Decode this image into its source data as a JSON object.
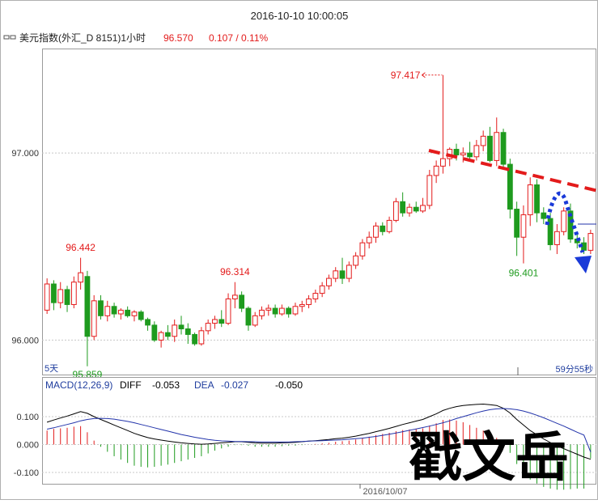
{
  "header": {
    "datetime": "2016-10-10 10:00:05",
    "instrument": "美元指数(外汇_D 8151)1小时",
    "last_price": "96.570",
    "change": "0.107 / 0.11%"
  },
  "colors": {
    "up": "#e31b1b",
    "down": "#1e9b1e",
    "price_text": "#e31b1b",
    "blue_text": "#1f3d9e",
    "diff_line": "#000000",
    "dea_line": "#2233aa",
    "trend_dash": "#e31b1b",
    "forecast_dots": "#1a3ad8",
    "grid": "#c8c8c8",
    "axis_text": "#333333"
  },
  "price_panel": {
    "y_labels": [
      "97.000",
      "96.000"
    ],
    "ylim": [
      95.82,
      97.55
    ],
    "bottom_left_label": "5天",
    "bottom_right_label": "59分55秒",
    "annotations": [
      {
        "text": "97.417",
        "price": 97.417,
        "index": 59,
        "color": "up"
      },
      {
        "text": "96.442",
        "price": 96.442,
        "index": 5,
        "color": "up"
      },
      {
        "text": "96.314",
        "price": 96.314,
        "index": 28,
        "color": "up"
      },
      {
        "text": "96.401",
        "price": 96.401,
        "index": 71,
        "color": "down"
      },
      {
        "text": "95.859",
        "price": 95.859,
        "index": 6,
        "color": "down"
      }
    ]
  },
  "macd_panel": {
    "title": "MACD(12,26,9)",
    "diff_label": "DIFF",
    "diff_value": "-0.053",
    "dea_label": "DEA",
    "dea_value": "-0.027",
    "macd_value": "-0.050",
    "y_labels": [
      "0.100",
      "0.000",
      "-0.100"
    ],
    "ylim": [
      -0.135,
      0.19
    ],
    "date_label": "2016/10/07"
  },
  "watermark": "戳文岳",
  "chart_data": [
    {
      "type": "candlestick",
      "title": "美元指数(外汇_D 8151)1小时",
      "ylim": [
        95.82,
        97.55
      ],
      "ohlc": [
        [
          96.16,
          96.33,
          96.14,
          96.3
        ],
        [
          96.3,
          96.32,
          96.16,
          96.2
        ],
        [
          96.2,
          96.31,
          96.17,
          96.27
        ],
        [
          96.27,
          96.29,
          96.15,
          96.19
        ],
        [
          96.19,
          96.34,
          96.17,
          96.31
        ],
        [
          96.31,
          96.44,
          96.27,
          96.36
        ],
        [
          96.34,
          96.37,
          95.86,
          96.02
        ],
        [
          96.02,
          96.24,
          96.0,
          96.21
        ],
        [
          96.21,
          96.24,
          96.11,
          96.13
        ],
        [
          96.13,
          96.21,
          96.1,
          96.18
        ],
        [
          96.18,
          96.2,
          96.12,
          96.14
        ],
        [
          96.14,
          96.17,
          96.11,
          96.16
        ],
        [
          96.16,
          96.18,
          96.12,
          96.13
        ],
        [
          96.13,
          96.16,
          96.1,
          96.15
        ],
        [
          96.15,
          96.16,
          96.1,
          96.11
        ],
        [
          96.11,
          96.12,
          96.05,
          96.08
        ],
        [
          96.08,
          96.1,
          95.99,
          96.0
        ],
        [
          96.0,
          96.05,
          95.96,
          96.04
        ],
        [
          96.04,
          96.08,
          96.0,
          96.02
        ],
        [
          96.02,
          96.11,
          95.99,
          96.08
        ],
        [
          96.08,
          96.13,
          96.03,
          96.06
        ],
        [
          96.06,
          96.09,
          95.98,
          96.03
        ],
        [
          96.03,
          96.04,
          95.97,
          95.98
        ],
        [
          95.98,
          96.07,
          95.97,
          96.05
        ],
        [
          96.05,
          96.11,
          96.03,
          96.09
        ],
        [
          96.09,
          96.13,
          96.06,
          96.11
        ],
        [
          96.11,
          96.16,
          96.07,
          96.09
        ],
        [
          96.09,
          96.25,
          96.08,
          96.22
        ],
        [
          96.22,
          96.31,
          96.17,
          96.24
        ],
        [
          96.24,
          96.26,
          96.15,
          96.17
        ],
        [
          96.17,
          96.18,
          96.05,
          96.08
        ],
        [
          96.08,
          96.15,
          96.07,
          96.13
        ],
        [
          96.13,
          96.18,
          96.11,
          96.16
        ],
        [
          96.16,
          96.19,
          96.13,
          96.17
        ],
        [
          96.17,
          96.19,
          96.12,
          96.14
        ],
        [
          96.14,
          96.19,
          96.13,
          96.17
        ],
        [
          96.17,
          96.18,
          96.12,
          96.14
        ],
        [
          96.14,
          96.2,
          96.13,
          96.18
        ],
        [
          96.18,
          96.21,
          96.15,
          96.19
        ],
        [
          96.19,
          96.24,
          96.17,
          96.22
        ],
        [
          96.22,
          96.27,
          96.2,
          96.25
        ],
        [
          96.25,
          96.31,
          96.23,
          96.29
        ],
        [
          96.29,
          96.35,
          96.27,
          96.33
        ],
        [
          96.33,
          96.39,
          96.31,
          96.37
        ],
        [
          96.37,
          96.44,
          96.3,
          96.33
        ],
        [
          96.33,
          96.42,
          96.31,
          96.4
        ],
        [
          96.4,
          96.47,
          96.38,
          96.45
        ],
        [
          96.45,
          96.54,
          96.43,
          96.52
        ],
        [
          96.52,
          96.58,
          96.49,
          96.55
        ],
        [
          96.55,
          96.63,
          96.52,
          96.61
        ],
        [
          96.61,
          96.63,
          96.56,
          96.58
        ],
        [
          96.58,
          96.66,
          96.57,
          96.64
        ],
        [
          96.64,
          96.76,
          96.63,
          96.74
        ],
        [
          96.74,
          96.79,
          96.66,
          96.68
        ],
        [
          96.68,
          96.73,
          96.66,
          96.71
        ],
        [
          96.71,
          96.74,
          96.68,
          96.69
        ],
        [
          96.69,
          96.76,
          96.68,
          96.72
        ],
        [
          96.72,
          96.91,
          96.7,
          96.88
        ],
        [
          96.88,
          96.96,
          96.84,
          96.93
        ],
        [
          96.93,
          97.417,
          96.89,
          96.97
        ],
        [
          96.97,
          97.03,
          96.93,
          97.02
        ],
        [
          97.02,
          97.05,
          96.96,
          96.99
        ],
        [
          96.99,
          97.03,
          96.95,
          97.0
        ],
        [
          97.0,
          97.06,
          96.97,
          96.98
        ],
        [
          96.98,
          97.07,
          96.96,
          97.04
        ],
        [
          97.04,
          97.12,
          97.01,
          97.09
        ],
        [
          97.09,
          97.14,
          96.95,
          96.96
        ],
        [
          96.96,
          97.19,
          96.93,
          97.11
        ],
        [
          97.11,
          97.13,
          96.91,
          96.94
        ],
        [
          96.94,
          96.97,
          96.65,
          96.7
        ],
        [
          96.7,
          96.74,
          96.45,
          96.55
        ],
        [
          96.55,
          96.72,
          96.41,
          96.67
        ],
        [
          96.67,
          96.87,
          96.61,
          96.83
        ],
        [
          96.83,
          96.86,
          96.63,
          96.68
        ],
        [
          96.68,
          96.71,
          96.62,
          96.65
        ],
        [
          96.65,
          96.68,
          96.48,
          96.51
        ],
        [
          96.51,
          96.62,
          96.46,
          96.58
        ],
        [
          96.58,
          96.71,
          96.56,
          96.69
        ],
        [
          96.69,
          96.73,
          96.52,
          96.54
        ],
        [
          96.54,
          96.57,
          96.49,
          96.52
        ],
        [
          96.52,
          96.55,
          96.46,
          96.48
        ],
        [
          96.48,
          96.59,
          96.46,
          96.57
        ]
      ]
    },
    {
      "type": "line",
      "title": "MACD(12,26,9)",
      "ylim": [
        -0.135,
        0.19
      ],
      "series": [
        {
          "name": "DIFF",
          "values": [
            0.08,
            0.088,
            0.095,
            0.102,
            0.11,
            0.118,
            0.112,
            0.1,
            0.09,
            0.08,
            0.07,
            0.06,
            0.05,
            0.04,
            0.032,
            0.025,
            0.02,
            0.016,
            0.012,
            0.009,
            0.006,
            0.004,
            0.002,
            0.001,
            0.002,
            0.004,
            0.006,
            0.008,
            0.01,
            0.01,
            0.008,
            0.006,
            0.005,
            0.005,
            0.005,
            0.006,
            0.007,
            0.008,
            0.01,
            0.012,
            0.014,
            0.016,
            0.018,
            0.021,
            0.023,
            0.026,
            0.03,
            0.035,
            0.04,
            0.046,
            0.052,
            0.058,
            0.065,
            0.072,
            0.078,
            0.084,
            0.09,
            0.1,
            0.11,
            0.122,
            0.13,
            0.136,
            0.14,
            0.142,
            0.144,
            0.145,
            0.143,
            0.14,
            0.13,
            0.113,
            0.09,
            0.07,
            0.05,
            0.035,
            0.02,
            0.007,
            -0.005,
            -0.015,
            -0.025,
            -0.035,
            -0.045,
            -0.053
          ]
        },
        {
          "name": "DEA",
          "values": [
            0.055,
            0.06,
            0.066,
            0.072,
            0.078,
            0.085,
            0.09,
            0.093,
            0.094,
            0.093,
            0.091,
            0.087,
            0.083,
            0.078,
            0.072,
            0.066,
            0.06,
            0.054,
            0.048,
            0.042,
            0.036,
            0.031,
            0.026,
            0.022,
            0.018,
            0.015,
            0.013,
            0.012,
            0.011,
            0.011,
            0.01,
            0.01,
            0.009,
            0.009,
            0.009,
            0.009,
            0.009,
            0.01,
            0.011,
            0.012,
            0.013,
            0.014,
            0.015,
            0.016,
            0.017,
            0.019,
            0.021,
            0.023,
            0.026,
            0.029,
            0.033,
            0.037,
            0.041,
            0.046,
            0.051,
            0.056,
            0.061,
            0.066,
            0.072,
            0.078,
            0.085,
            0.093,
            0.1,
            0.107,
            0.114,
            0.12,
            0.125,
            0.128,
            0.129,
            0.128,
            0.125,
            0.12,
            0.113,
            0.105,
            0.096,
            0.086,
            0.076,
            0.066,
            0.055,
            0.044,
            0.034,
            -0.027
          ]
        },
        {
          "name": "MACD",
          "values": [
            0.05,
            0.056,
            0.058,
            0.06,
            0.064,
            0.066,
            0.044,
            0.014,
            -0.008,
            -0.026,
            -0.042,
            -0.054,
            -0.066,
            -0.076,
            -0.08,
            -0.082,
            -0.08,
            -0.076,
            -0.072,
            -0.066,
            -0.06,
            -0.054,
            -0.048,
            -0.042,
            -0.032,
            -0.022,
            -0.014,
            -0.008,
            -0.002,
            -0.002,
            -0.004,
            -0.008,
            -0.008,
            -0.008,
            -0.008,
            -0.006,
            -0.004,
            -0.004,
            -0.002,
            0,
            0.002,
            0.004,
            0.006,
            0.01,
            0.012,
            0.014,
            0.018,
            0.024,
            0.028,
            0.034,
            0.038,
            0.042,
            0.048,
            0.052,
            0.054,
            0.056,
            0.058,
            0.068,
            0.076,
            0.088,
            0.09,
            0.086,
            0.08,
            0.07,
            0.06,
            0.05,
            0.036,
            0.024,
            0.002,
            -0.03,
            -0.07,
            -0.1,
            -0.126,
            -0.14,
            -0.152,
            -0.158,
            -0.162,
            -0.162,
            -0.16,
            -0.158,
            -0.158,
            -0.05
          ]
        }
      ]
    }
  ]
}
